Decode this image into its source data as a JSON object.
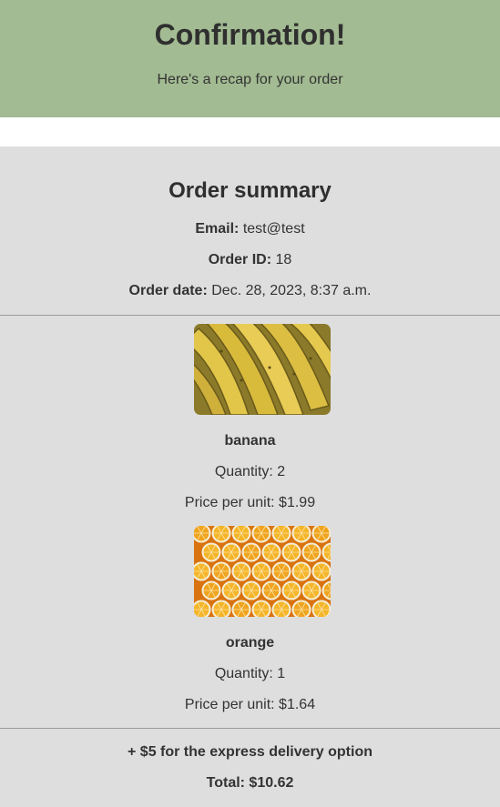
{
  "header": {
    "title": "Confirmation!",
    "subtitle": "Here's a recap for your order",
    "background_color": "#a2bb92"
  },
  "summary": {
    "title": "Order summary",
    "email_label": "Email:",
    "email_value": "test@test",
    "order_id_label": "Order ID:",
    "order_id_value": "18",
    "order_date_label": "Order date:",
    "order_date_value": "Dec. 28, 2023, 8:37 a.m."
  },
  "items": [
    {
      "name": "banana",
      "image_icon": "banana-photo",
      "quantity_text": "Quantity: 2",
      "price_text": "Price per unit: $1.99"
    },
    {
      "name": "orange",
      "image_icon": "orange-photo",
      "quantity_text": "Quantity: 1",
      "price_text": "Price per unit: $1.64"
    }
  ],
  "totals": {
    "delivery_text": "+ $5 for the express delivery option",
    "total_text": "Total: $10.62"
  }
}
